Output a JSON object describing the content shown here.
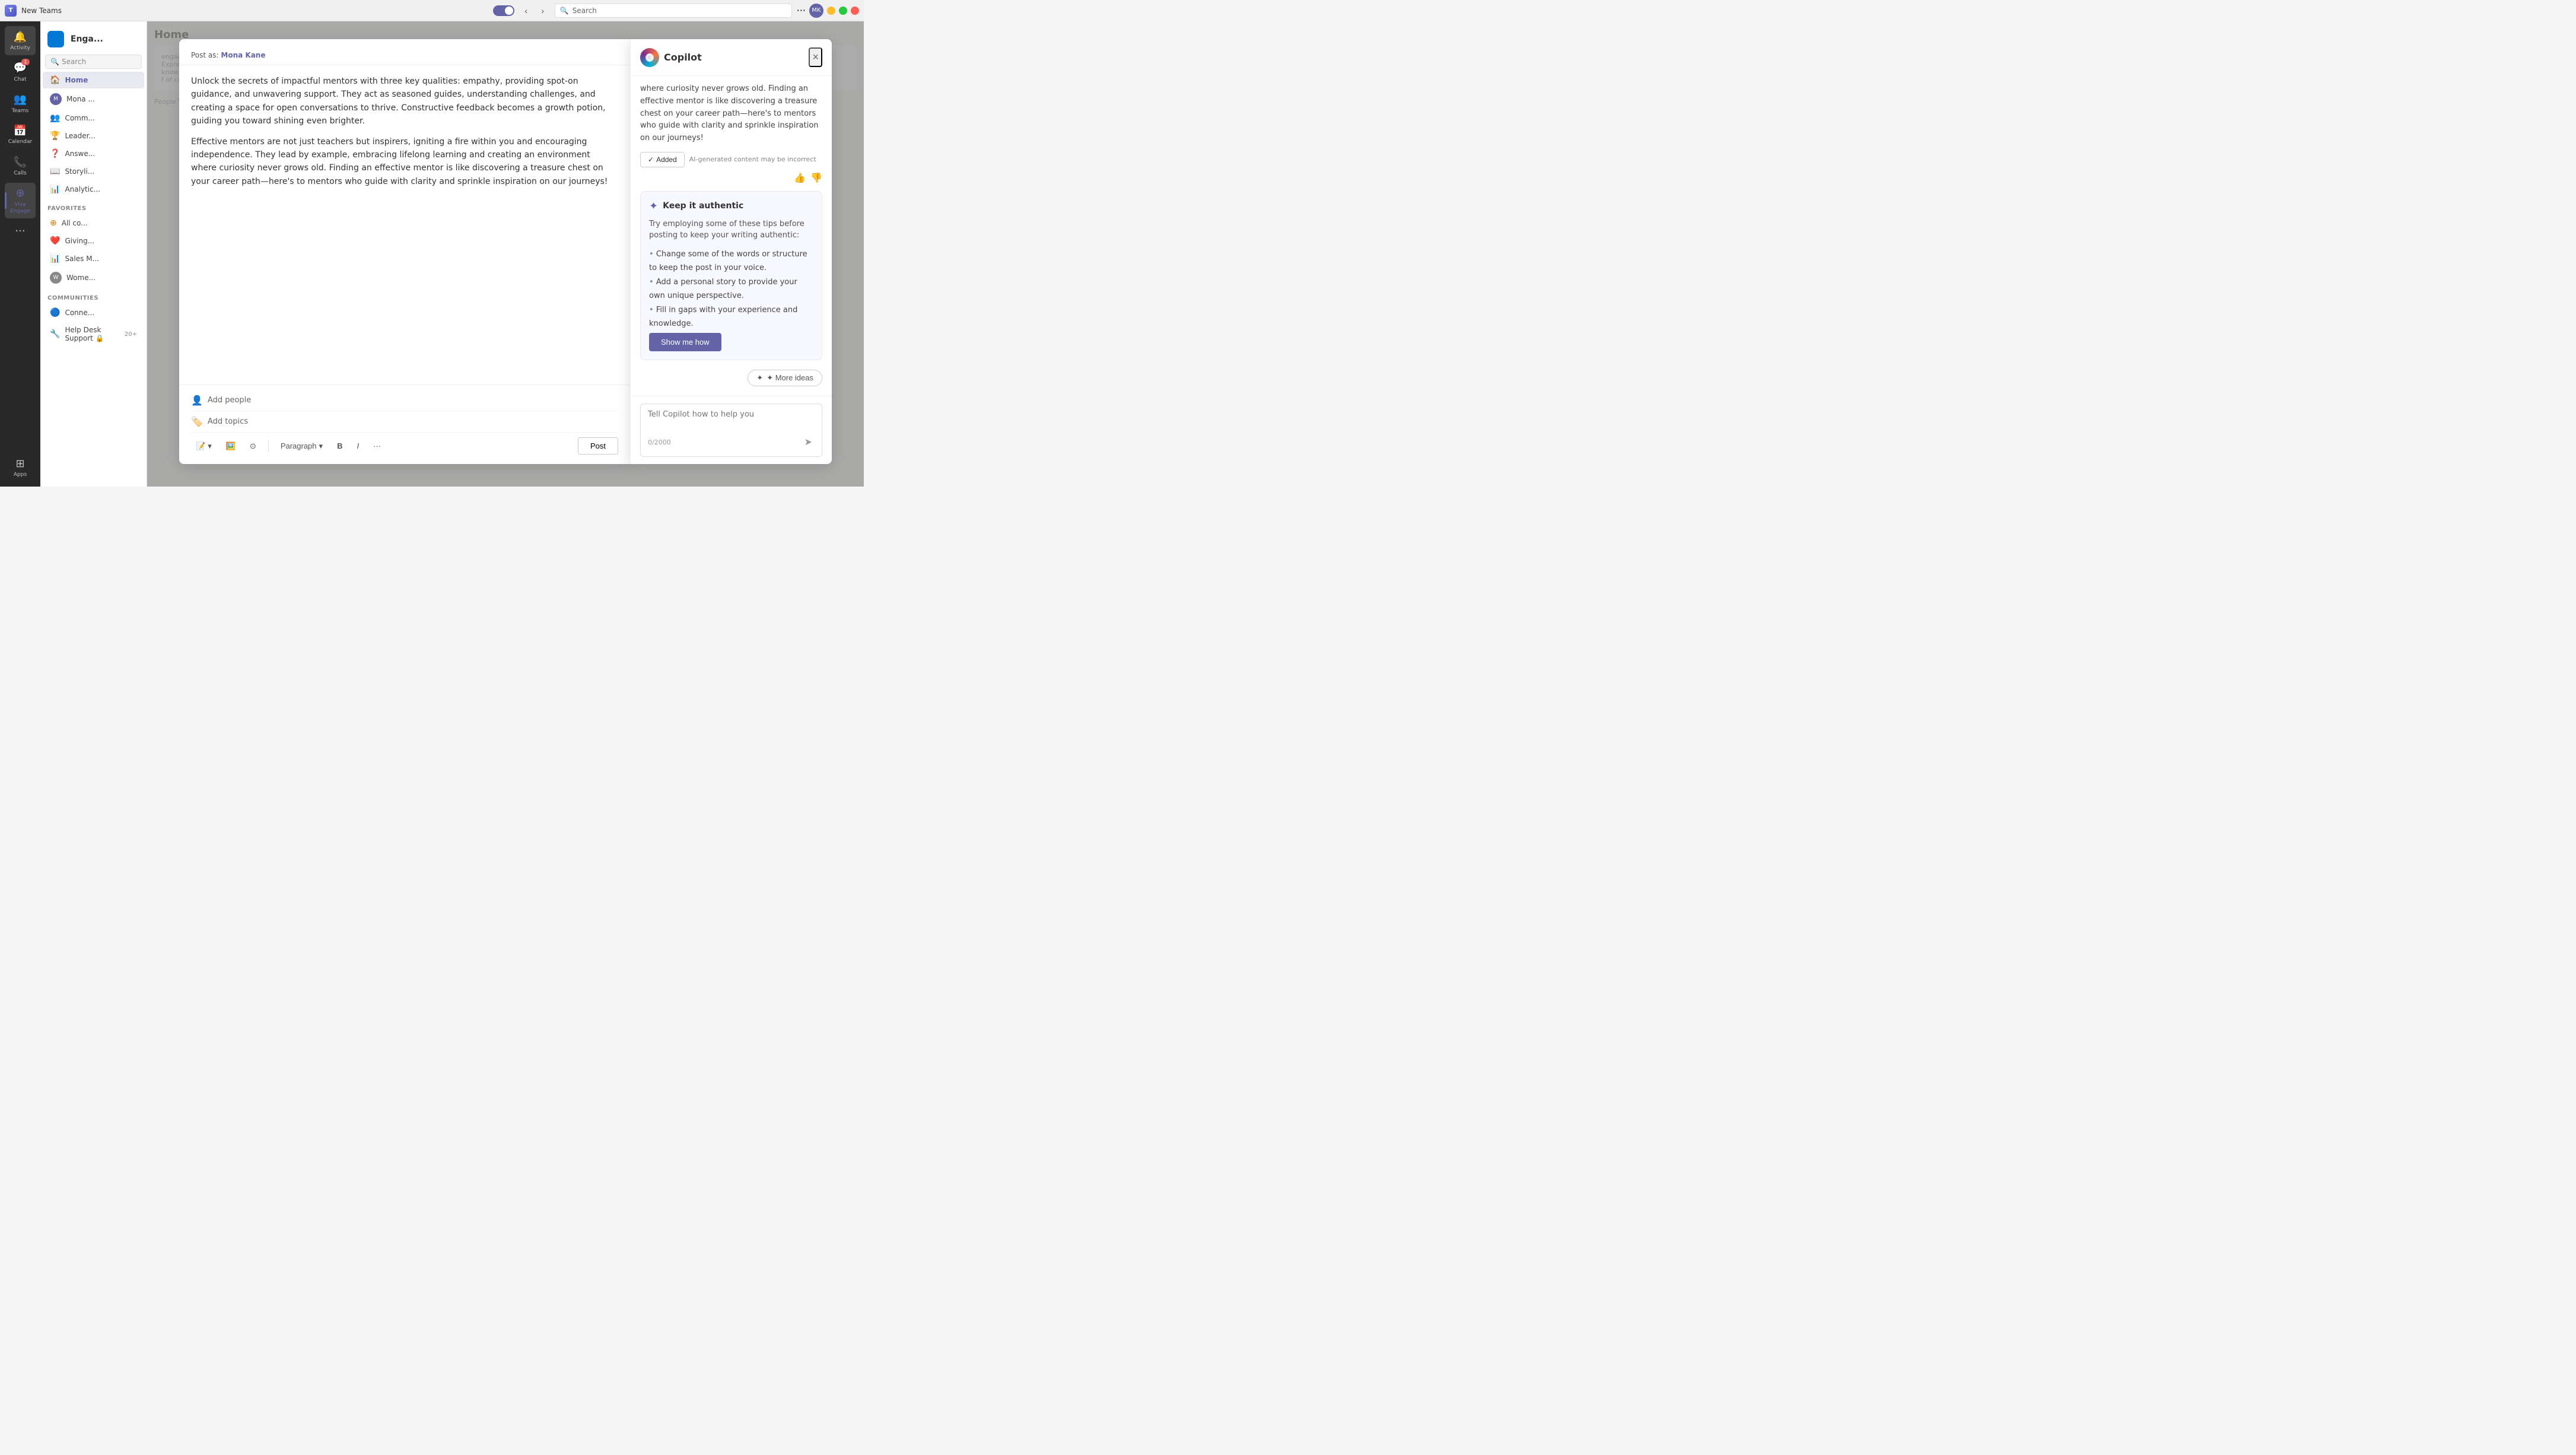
{
  "titlebar": {
    "app_name": "New Teams",
    "search_placeholder": "Search"
  },
  "sidebar": {
    "items": [
      {
        "id": "activity",
        "label": "Activity",
        "icon": "🔔",
        "badge": null
      },
      {
        "id": "chat",
        "label": "Chat",
        "icon": "💬",
        "badge": "1"
      },
      {
        "id": "teams",
        "label": "Teams",
        "icon": "👥",
        "badge": null
      },
      {
        "id": "calendar",
        "label": "Calendar",
        "icon": "📅",
        "badge": null
      },
      {
        "id": "calls",
        "label": "Calls",
        "icon": "📞",
        "badge": null
      },
      {
        "id": "viva-engage",
        "label": "Viva Engage",
        "icon": "⊕",
        "badge": null,
        "active": true
      },
      {
        "id": "more",
        "label": "···",
        "icon": "···",
        "badge": null
      },
      {
        "id": "apps",
        "label": "Apps",
        "icon": "⊞",
        "badge": null
      }
    ]
  },
  "left_panel": {
    "header": "Enga...",
    "search_placeholder": "Search",
    "nav_items": [
      {
        "id": "home",
        "label": "Home",
        "icon": "🏠",
        "active": true
      },
      {
        "id": "mona",
        "label": "Mona ...",
        "icon": "👤"
      }
    ],
    "nav_links": [
      {
        "id": "communities",
        "label": "Comm...",
        "icon": "👥"
      },
      {
        "id": "leadership",
        "label": "Leader...",
        "icon": "🏆"
      },
      {
        "id": "answers",
        "label": "Answe...",
        "icon": "❓"
      },
      {
        "id": "storylines",
        "label": "Storyli...",
        "icon": "📖"
      },
      {
        "id": "analytics",
        "label": "Analytic...",
        "icon": "📊"
      }
    ],
    "favorites_title": "Favorites",
    "favorites": [
      {
        "id": "all-co",
        "label": "All co...",
        "icon": "🟠"
      },
      {
        "id": "giving",
        "label": "Giving...",
        "icon": "❤️"
      },
      {
        "id": "sales",
        "label": "Sales M...",
        "icon": "🟡"
      },
      {
        "id": "women",
        "label": "Wome...",
        "icon": "👤"
      }
    ],
    "communities_title": "Communities",
    "communities": [
      {
        "id": "conne",
        "label": "Conne...",
        "icon": "🔵"
      },
      {
        "id": "helpdesk",
        "label": "Help Desk Support 🔒",
        "badge": "20+"
      }
    ]
  },
  "post_editor": {
    "post_as_label": "Post as:",
    "post_as_name": "Mona Kane",
    "body_paragraphs": [
      "Unlock the secrets of impactful mentors with three key qualities: empathy, providing spot-on guidance, and unwavering support. They act as seasoned guides, understanding challenges, and creating a space for open conversations to thrive. Constructive feedback becomes a growth potion, guiding you toward shining even brighter.",
      "Effective mentors are not just teachers but inspirers, igniting a fire within you and encouraging independence. They lead by example, embracing lifelong learning and creating an environment where curiosity never grows old. Finding an effective mentor is like discovering a treasure chest on your career path—here's to mentors who guide with clarity and sprinkle inspiration on our journeys!"
    ],
    "add_people_label": "Add people",
    "add_topics_label": "Add topics",
    "format_label": "Paragraph",
    "bold_label": "B",
    "italic_label": "I",
    "more_label": "···",
    "post_button": "Post"
  },
  "copilot": {
    "title": "Copilot",
    "close_label": "×",
    "generated_text": "where curiosity never grows old. Finding an effective mentor is like discovering a treasure chest on your career path—here's to mentors who guide with clarity and sprinkle inspiration on our journeys!",
    "added_button": "✓ Added",
    "ai_disclaimer": "AI-generated content may be incorrect",
    "keep_authentic": {
      "title": "Keep it authentic",
      "subtitle": "Try employing some of these tips before posting to keep your writing authentic:",
      "tips": [
        "Change some of the words or structure to keep the post in your voice.",
        "Add a personal story to provide your own unique perspective.",
        "Fill in gaps with your experience and knowledge."
      ],
      "show_me_how": "Show me how"
    },
    "more_ideas_label": "✦ More ideas",
    "input_placeholder": "Tell Copilot how to help you",
    "char_count": "0/2000"
  },
  "people_you_might_know": "People You Might Know"
}
